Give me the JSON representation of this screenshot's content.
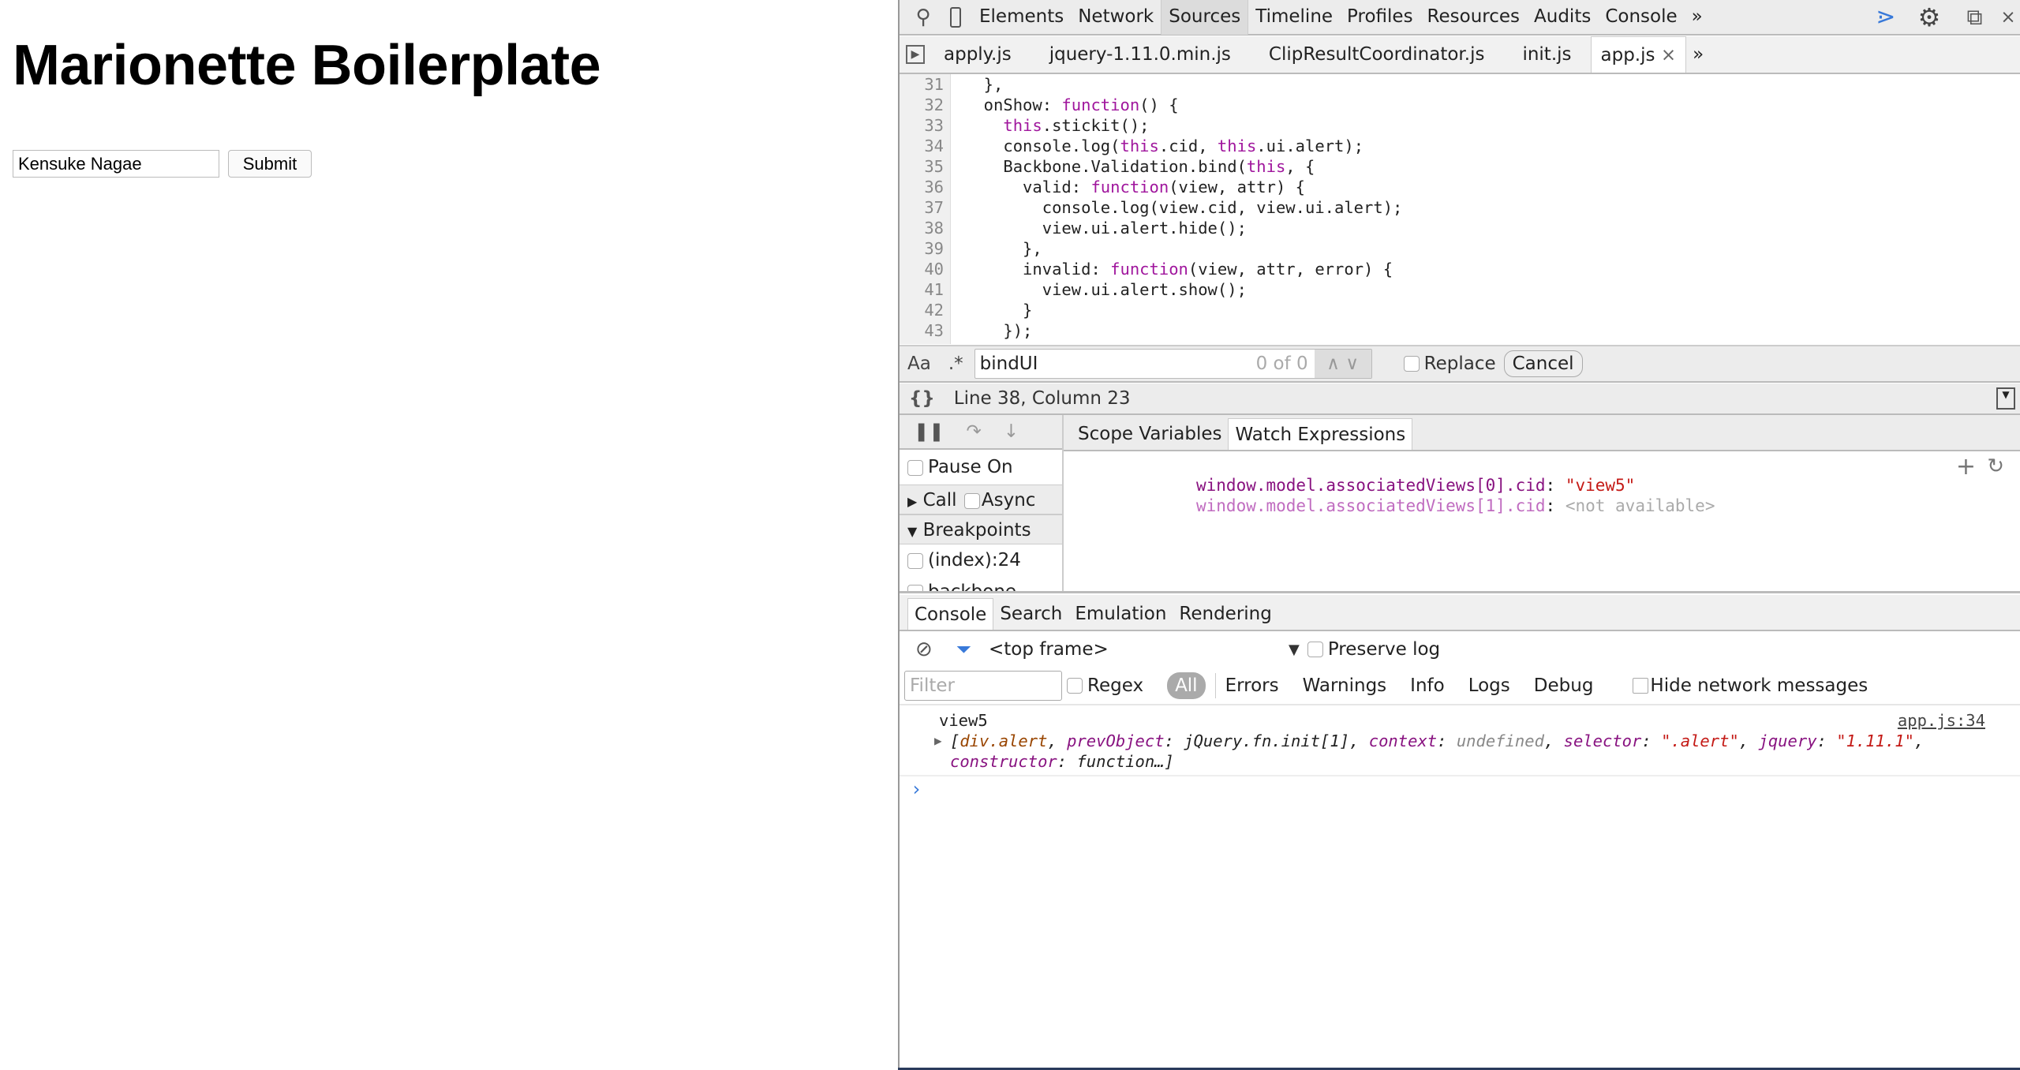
{
  "page": {
    "title": "Marionette Boilerplate",
    "input_value": "Kensuke Nagae",
    "submit_label": "Submit"
  },
  "devtools": {
    "toolbar": {
      "tabs": [
        "Elements",
        "Network",
        "Sources",
        "Timeline",
        "Profiles",
        "Resources",
        "Audits",
        "Console"
      ],
      "selected": "Sources",
      "more": "»",
      "close": "×"
    },
    "files": {
      "tabs": [
        "apply.js",
        "jquery-1.11.0.min.js",
        "ClipResultCoordinator.js",
        "init.js",
        "app.js"
      ],
      "selected": "app.js",
      "close": "×",
      "more": "»"
    },
    "code": [
      {
        "n": "31",
        "t": "  },"
      },
      {
        "n": "32",
        "t": "  onShow: function() {"
      },
      {
        "n": "33",
        "t": "    this.stickit();"
      },
      {
        "n": "34",
        "t": "    console.log(this.cid, this.ui.alert);"
      },
      {
        "n": "35",
        "t": "    Backbone.Validation.bind(this, {"
      },
      {
        "n": "36",
        "t": "      valid: function(view, attr) {"
      },
      {
        "n": "37",
        "t": "        console.log(view.cid, view.ui.alert);"
      },
      {
        "n": "38",
        "t": "        view.ui.alert.hide();"
      },
      {
        "n": "39",
        "t": "      },"
      },
      {
        "n": "40",
        "t": "      invalid: function(view, attr, error) {"
      },
      {
        "n": "41",
        "t": "        view.ui.alert.show();"
      },
      {
        "n": "42",
        "t": "      }"
      },
      {
        "n": "43",
        "t": "    });"
      }
    ],
    "search": {
      "case_label": "Aa",
      "regex_label": ".*",
      "query": "bindUI",
      "count": "0 of 0",
      "replace_label": "Replace",
      "cancel_label": "Cancel"
    },
    "status": {
      "format_label": "{}",
      "position": "Line 38, Column 23"
    },
    "debugger": {
      "sidebar": {
        "pause_label": "Pause On",
        "call_label": "Call",
        "async_label": "Async",
        "breakpoints_label": "Breakpoints",
        "breakpoint": "(index):24",
        "breakpoint2": "backbone"
      },
      "tabs": [
        "Scope Variables",
        "Watch Expressions"
      ],
      "selected": "Watch Expressions",
      "watch": [
        {
          "expr": "window.model.associatedViews[0].cid",
          "value": "\"view5\""
        },
        {
          "expr": "window.model.associatedViews[1].cid",
          "value": "<not available>"
        }
      ]
    },
    "drawer": {
      "tabs": [
        "Console",
        "Search",
        "Emulation",
        "Rendering"
      ],
      "selected": "Console"
    },
    "console": {
      "frame": "<top frame>",
      "preserve_label": "Preserve log",
      "filter_placeholder": "Filter",
      "regex_label": "Regex",
      "levels": [
        "All",
        "Errors",
        "Warnings",
        "Info",
        "Logs",
        "Debug"
      ],
      "hide_network_label": "Hide network messages",
      "messages": {
        "line1": "view5",
        "source": "app.js:34",
        "obj_a": "div.alert",
        "k1": "prevObject",
        "v1": "jQuery.fn.init[1]",
        "k2": "context",
        "v2": "undefined",
        "k3": "selector",
        "v3": "\".alert\"",
        "k4": "jquery",
        "v4": "\"1.11.1\"",
        "k5": "constructor",
        "v5": "function…"
      },
      "prompt": "›"
    },
    "colors": {
      "keyword": "#a0169d",
      "string": "#c41a16",
      "accent": "#3879d9"
    }
  }
}
